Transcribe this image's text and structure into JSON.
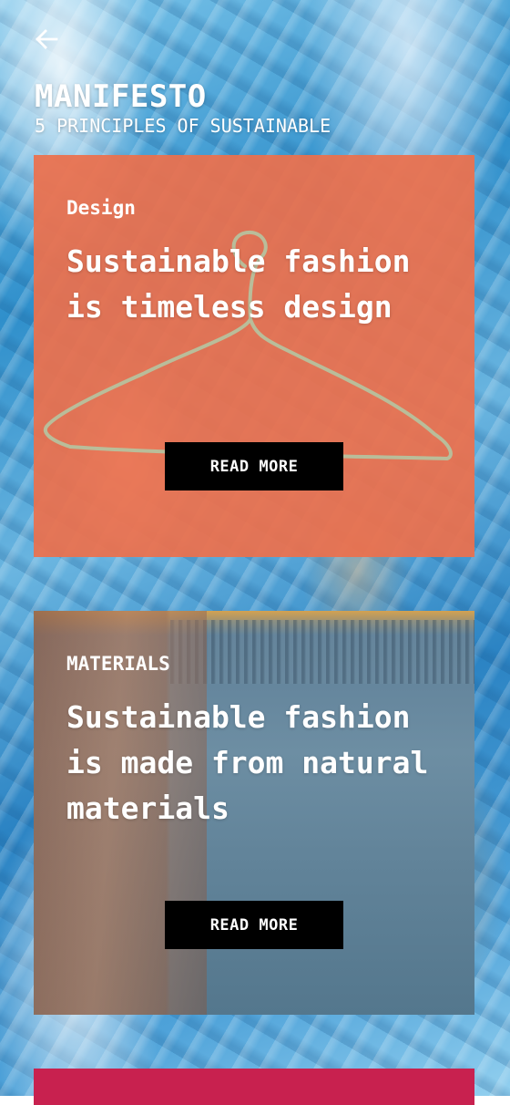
{
  "header": {
    "back_icon": "arrow-left-icon",
    "title": "MANIFESTO",
    "subtitle": "5 PRINCIPLES OF SUSTAINABLE"
  },
  "cards": [
    {
      "category": "Design",
      "headline": "Sustainable fashion is timeless design",
      "button_label": "READ MORE",
      "color": "#EC704C"
    },
    {
      "category": "MATERIALS",
      "headline": "Sustainable fashion is made from natural materials",
      "button_label": "READ MORE",
      "color": "#5C7D96"
    },
    {
      "color": "#C8214F"
    }
  ],
  "colors": {
    "background_accent": "#2F8FCB",
    "button": "#000000",
    "text": "#FFFFFF"
  }
}
